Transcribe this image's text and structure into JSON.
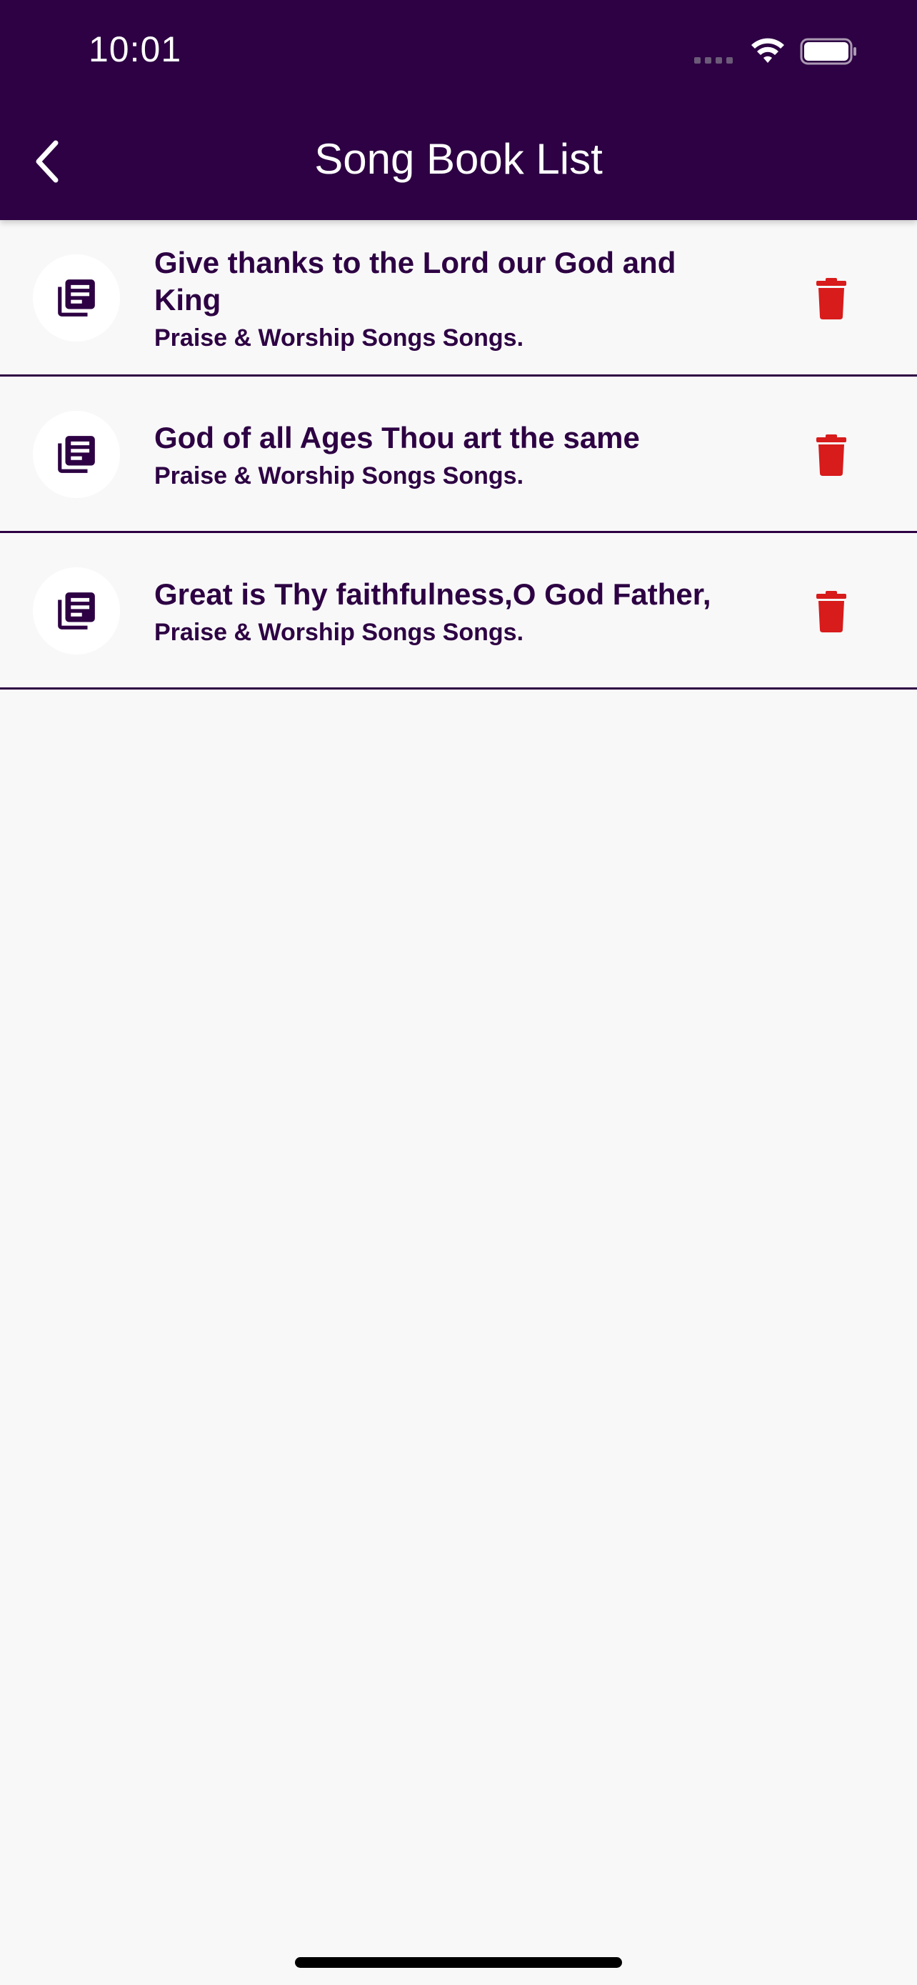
{
  "status_bar": {
    "time": "10:01"
  },
  "header": {
    "title": "Song Book List",
    "back_icon": "chevron-left-icon",
    "background_color": "#2d0143"
  },
  "songs": [
    {
      "title": "Give thanks to the Lord our God and King",
      "subtitle": "Praise & Worship Songs Songs.",
      "icon": "library-books-icon",
      "action_icon": "trash-icon"
    },
    {
      "title": "God of all Ages Thou art the same",
      "subtitle": "Praise & Worship Songs Songs.",
      "icon": "library-books-icon",
      "action_icon": "trash-icon"
    },
    {
      "title": "Great is Thy faithfulness,O God Father,",
      "subtitle": "Praise & Worship Songs Songs.",
      "icon": "library-books-icon",
      "action_icon": "trash-icon"
    }
  ],
  "colors": {
    "primary": "#2d0143",
    "delete": "#d81b1b",
    "background": "#f8f8f8"
  }
}
